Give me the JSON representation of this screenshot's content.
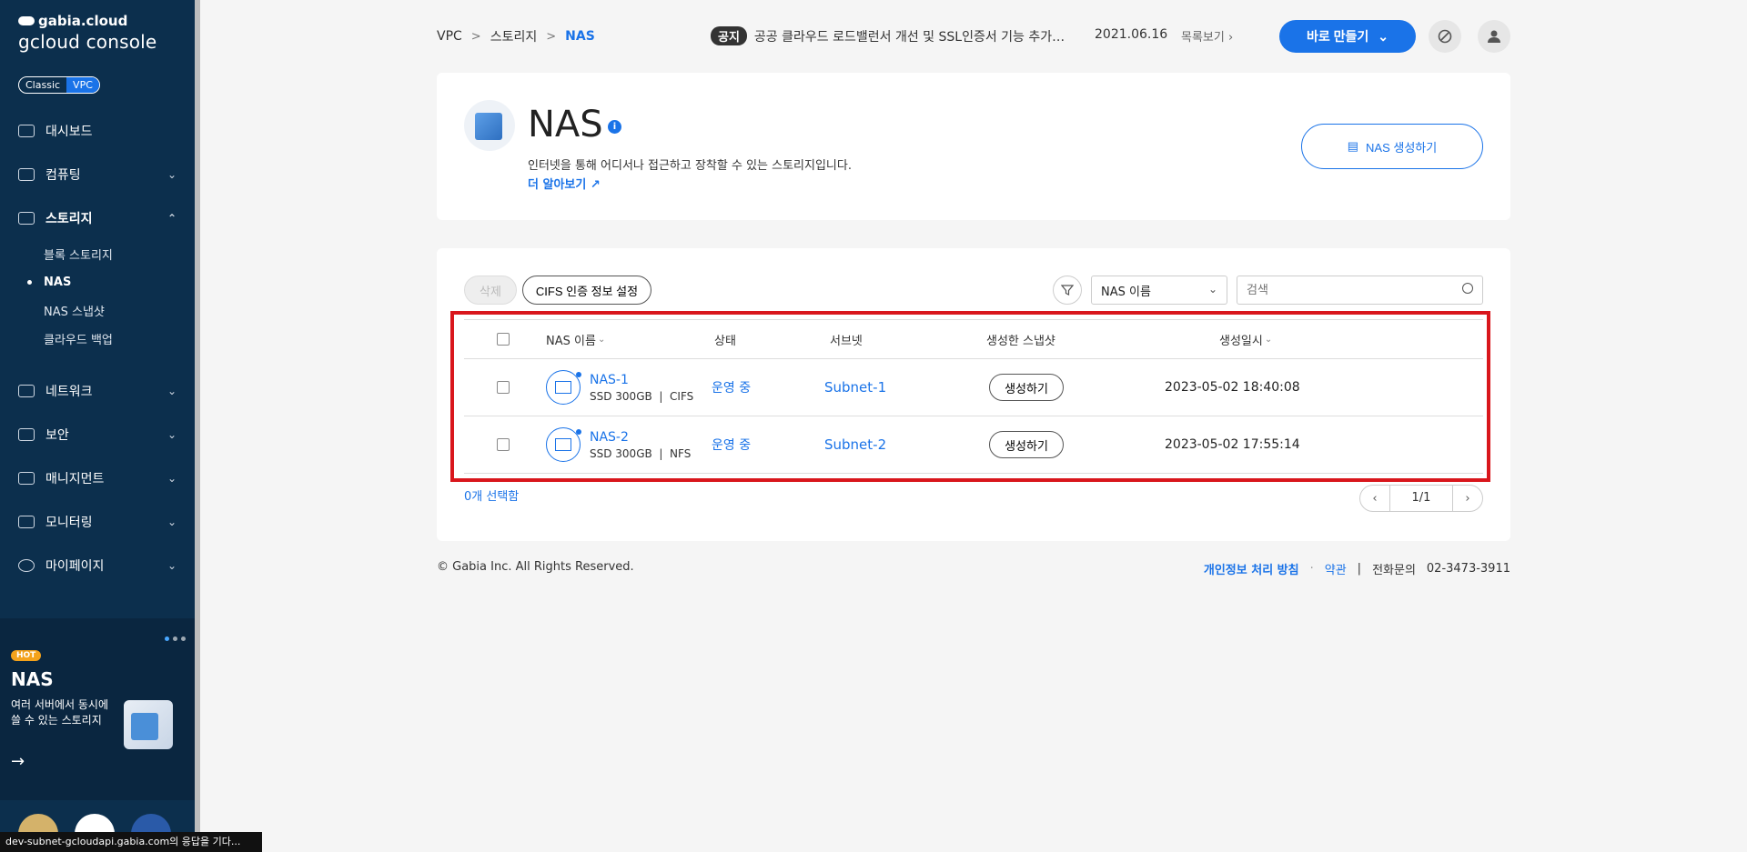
{
  "sidebar": {
    "brand_small": "gabia.cloud",
    "brand_large": "gcloud console",
    "mode_classic": "Classic",
    "mode_vpc": "VPC",
    "items": [
      {
        "label": "대시보드"
      },
      {
        "label": "컴퓨팅"
      },
      {
        "label": "스토리지"
      },
      {
        "label": "네트워크"
      },
      {
        "label": "보안"
      },
      {
        "label": "매니지먼트"
      },
      {
        "label": "모니터링"
      },
      {
        "label": "마이페이지"
      }
    ],
    "storage_sub": [
      {
        "label": "블록 스토리지"
      },
      {
        "label": "NAS"
      },
      {
        "label": "NAS 스냅샷"
      },
      {
        "label": "클라우드 백업"
      }
    ],
    "promo": {
      "tag": "HOT",
      "title": "NAS",
      "desc": "여러 서버에서 동시에 쓸 수 있는 스토리지",
      "arrow": "→"
    }
  },
  "header": {
    "breadcrumb": [
      "VPC",
      "스토리지",
      "NAS"
    ],
    "notice_tag": "공지",
    "notice_text": "공공 클라우드 로드밸런서 개선 및 SSL인증서 기능 추가 안내",
    "notice_date": "2021.06.16",
    "notice_more": "목록보기",
    "quick_btn": "바로 만들기"
  },
  "hero": {
    "title": "NAS",
    "desc": "인터넷을 통해 어디서나 접근하고 장착할 수 있는 스토리지입니다.",
    "link": "더 알아보기",
    "create_btn": "NAS 생성하기"
  },
  "toolbar": {
    "delete": "삭제",
    "cifs": "CIFS 인증 정보 설정",
    "select_value": "NAS 이름",
    "search_placeholder": "검색"
  },
  "table": {
    "headers": {
      "name": "NAS 이름",
      "status": "상태",
      "subnet": "서브넷",
      "snapshot": "생성한 스냅샷",
      "created": "생성일시"
    },
    "rows": [
      {
        "name": "NAS-1",
        "spec": "SSD 300GB",
        "protocol": "CIFS",
        "status": "운영 중",
        "subnet": "Subnet-1",
        "snapshot_btn": "생성하기",
        "created": "2023-05-02 18:40:08"
      },
      {
        "name": "NAS-2",
        "spec": "SSD 300GB",
        "protocol": "NFS",
        "status": "운영 중",
        "subnet": "Subnet-2",
        "snapshot_btn": "생성하기",
        "created": "2023-05-02 17:55:14"
      }
    ],
    "selected_count": "0개 선택함",
    "page": "1/1"
  },
  "footer": {
    "copyright": "© Gabia Inc. All Rights Reserved.",
    "privacy": "개인정보 처리 방침",
    "terms": "약관",
    "contact_label": "전화문의",
    "contact_number": "02-3473-3911"
  },
  "status_bar": "dev-subnet-gcloudapi.gabia.com의 응답을 기다...",
  "colors": {
    "accent": "#1a73e8",
    "sidebar": "#0c2f4d",
    "highlight": "#d9161c"
  }
}
